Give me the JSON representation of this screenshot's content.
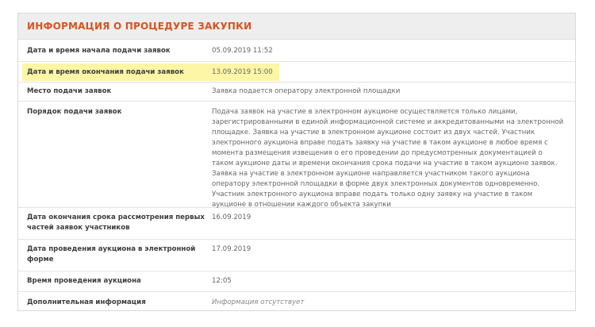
{
  "panel": {
    "title": "ИНФОРМАЦИЯ О ПРОЦЕДУРЕ ЗАКУПКИ"
  },
  "rows": [
    {
      "label": "Дата и время начала подачи заявок",
      "value": "05.09.2019 11:52"
    },
    {
      "label": "Дата и время окончания подачи заявок",
      "value": "13.09.2019 15:00"
    },
    {
      "label": "Место подачи заявок",
      "value": "Заявка подается оператору электронной площадки"
    },
    {
      "label": "Порядок подачи заявок",
      "value": "Подача заявок на участие в электронном аукционе осуществляется только лицами, зарегистрированными в единой информационной системе и аккредитованными на электронной площадке. Заявка на участие в электронном аукционе состоит из двух частей. Участник электронного аукциона вправе подать заявку на участие в таком аукционе в любое время с момента размещения извещения о его проведении до предусмотренных документацией о таком аукционе даты и времени окончания срока подачи на участие в таком аукционе заявок. Заявка на участие в электронном аукционе направляется участником такого аукциона оператору электронной площадки в форме двух электронных документов одновременно. Участник электронного аукциона вправе подать только одну заявку на участие в таком аукционе в отношении каждого объекта закупки"
    },
    {
      "label": "Дата окончания срока рассмотрения первых частей заявок участников",
      "value": "16.09.2019"
    },
    {
      "label": "Дата проведения аукциона в электронной форме",
      "value": "17.09.2019"
    },
    {
      "label": "Время проведения аукциона",
      "value": "12:05"
    },
    {
      "label": "Дополнительная информация",
      "value": "Информация отсутствует"
    }
  ],
  "colors": {
    "title": "#d9531e",
    "highlight": "#fdf6a6"
  }
}
